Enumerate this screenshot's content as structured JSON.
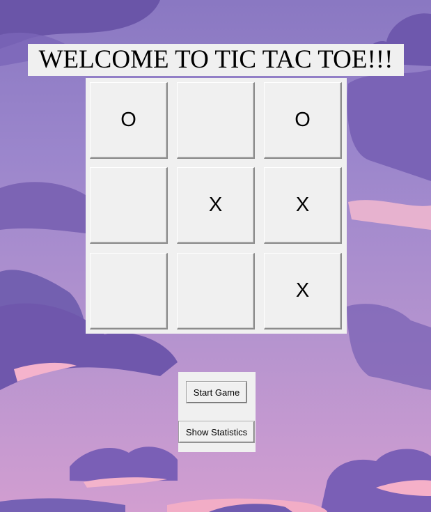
{
  "game": {
    "title": "WELCOME TO TIC TAC TOE!!!",
    "board": [
      [
        "O",
        "",
        "O"
      ],
      [
        "",
        "X",
        "X"
      ],
      [
        "",
        "",
        "X"
      ]
    ]
  },
  "controls": {
    "start_label": "Start Game",
    "stats_label": "Show Statistics"
  },
  "colors": {
    "panel": "#f0f0f0",
    "sky_top": "#8a78c2",
    "sky_bottom": "#d29ed0"
  }
}
